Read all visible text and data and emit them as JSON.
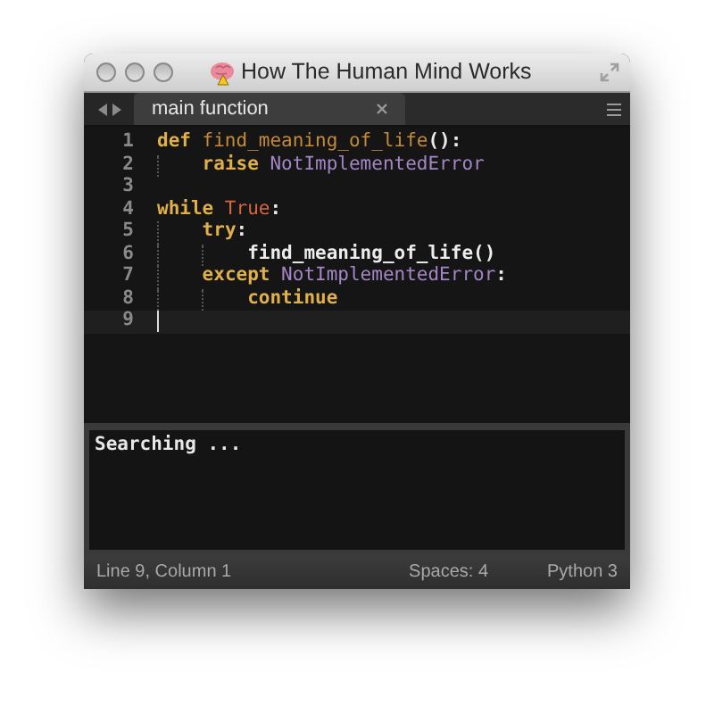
{
  "window": {
    "title": "How The Human Mind Works"
  },
  "tabs": [
    {
      "label": "main function",
      "selected": true
    }
  ],
  "editor": {
    "lines": [
      {
        "number": "1",
        "current": false,
        "tokens": [
          {
            "kind": "keyword",
            "text": "def"
          },
          {
            "kind": "function",
            "text": " find_meaning_of_life"
          },
          {
            "kind": "plain",
            "text": "():"
          }
        ],
        "children": [
          {
            "number": "2",
            "current": false,
            "tokens": [
              {
                "kind": "keyword",
                "text": "raise"
              },
              {
                "kind": "class",
                "text": " NotImplementedError"
              }
            ]
          }
        ]
      },
      {
        "number": "3",
        "current": false
      },
      {
        "number": "4",
        "current": false,
        "tokens": [
          {
            "kind": "keyword",
            "text": "while"
          },
          {
            "kind": "constant",
            "text": " True"
          },
          {
            "kind": "plain",
            "text": ":"
          }
        ],
        "children": [
          {
            "number": "5",
            "current": false,
            "tokens": [
              {
                "kind": "keyword",
                "text": "try"
              },
              {
                "kind": "plain",
                "text": ":"
              }
            ],
            "children": [
              {
                "number": "6",
                "current": false,
                "tokens": [
                  {
                    "kind": "plain",
                    "text": "find_meaning_of_life()"
                  }
                ]
              }
            ]
          },
          {
            "number": "7",
            "current": false,
            "tokens": [
              {
                "kind": "keyword",
                "text": "except"
              },
              {
                "kind": "class",
                "text": " NotImplementedError"
              },
              {
                "kind": "plain",
                "text": ":"
              }
            ],
            "children": [
              {
                "number": "8",
                "current": false,
                "tokens": [
                  {
                    "kind": "keyword",
                    "text": "continue"
                  }
                ]
              }
            ]
          }
        ]
      },
      {
        "number": "9",
        "current": true
      }
    ]
  },
  "output": {
    "text": "Searching ..."
  },
  "status_bar": {
    "position": "Line 9, Column 1",
    "indentation": "Spaces: 4",
    "syntax": "Python 3"
  }
}
